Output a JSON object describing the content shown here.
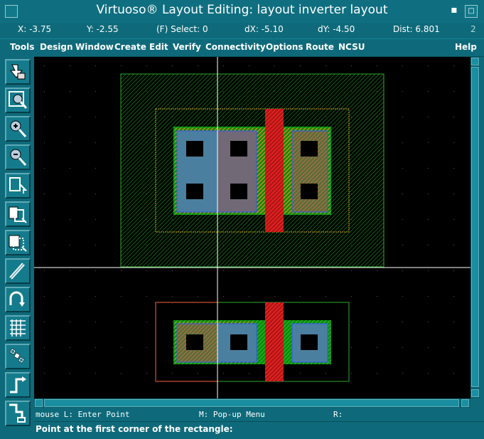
{
  "window": {
    "title": "Virtuoso® Layout Editing: layout inverter layout",
    "badge": "2"
  },
  "coords": {
    "x": "X: -3.75",
    "y": "Y: -2.55",
    "select": "(F) Select: 0",
    "dx": "dX: -5.10",
    "dy": "dY: -4.50",
    "dist": "Dist: 6.801"
  },
  "menu": [
    "Tools",
    "Design",
    "Window",
    "Create",
    "Edit",
    "Verify",
    "Connectivity",
    "Options",
    "Route",
    "NCSU"
  ],
  "menu_help": "Help",
  "tools": [
    {
      "name": "save-view-icon"
    },
    {
      "name": "zoom-fit-icon"
    },
    {
      "name": "zoom-in-icon"
    },
    {
      "name": "zoom-out-icon"
    },
    {
      "name": "stretch-icon"
    },
    {
      "name": "copy-icon"
    },
    {
      "name": "move-icon"
    },
    {
      "name": "delete-icon"
    },
    {
      "name": "undo-icon"
    },
    {
      "name": "properties-icon"
    },
    {
      "name": "ruler-icon"
    },
    {
      "name": "path-icon"
    },
    {
      "name": "rectangle-icon"
    }
  ],
  "mouse": {
    "left": "mouse L: Enter Point",
    "middle": "M: Pop-up Menu",
    "right": "R:"
  },
  "prompt": "Point at the first corner of the rectangle:"
}
